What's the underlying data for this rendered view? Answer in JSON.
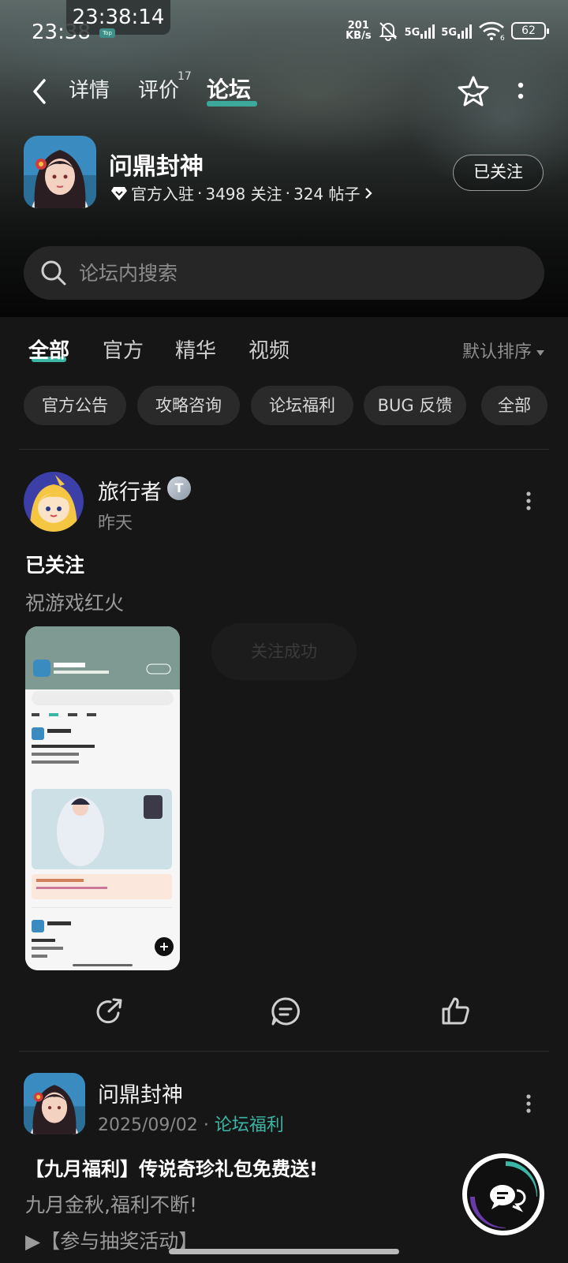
{
  "status_bar": {
    "time": "23:38",
    "clock_overlay": "23:38:14",
    "top_tag": "Top",
    "net_speed_value": "201",
    "net_speed_unit": "KB/s",
    "signal1": "5G",
    "signal2": "5G",
    "wifi_sub": "6",
    "battery": "62"
  },
  "nav": {
    "tabs": [
      {
        "label": "详情"
      },
      {
        "label": "评价"
      },
      {
        "label": "论坛"
      }
    ],
    "review_count": "17"
  },
  "game": {
    "title": "问鼎封神",
    "official": "官方入驻",
    "followers": "3498 关注",
    "posts": "324 帖子",
    "follow_btn": "已关注"
  },
  "search": {
    "placeholder": "论坛内搜索"
  },
  "categories": [
    {
      "label": "全部"
    },
    {
      "label": "官方"
    },
    {
      "label": "精华"
    },
    {
      "label": "视频"
    }
  ],
  "sort_label": "默认排序",
  "chips": [
    {
      "label": "官方公告"
    },
    {
      "label": "攻略咨询"
    },
    {
      "label": "论坛福利"
    },
    {
      "label": "BUG 反馈"
    },
    {
      "label": "全部"
    }
  ],
  "post1": {
    "author": "旅行者",
    "level_badge": "T",
    "time": "昨天",
    "title": "已关注",
    "body": "祝游戏红火",
    "toast": "关注成功"
  },
  "post2": {
    "author": "问鼎封神",
    "date": "2025/09/02",
    "tag": "论坛福利",
    "title": "【九月福利】传说奇珍礼包免费送!",
    "body": "九月金秋,福利不断!",
    "more": "▶【参与抽奖活动】"
  },
  "colors": {
    "accent": "#3bb5a4",
    "background": "#161616"
  }
}
